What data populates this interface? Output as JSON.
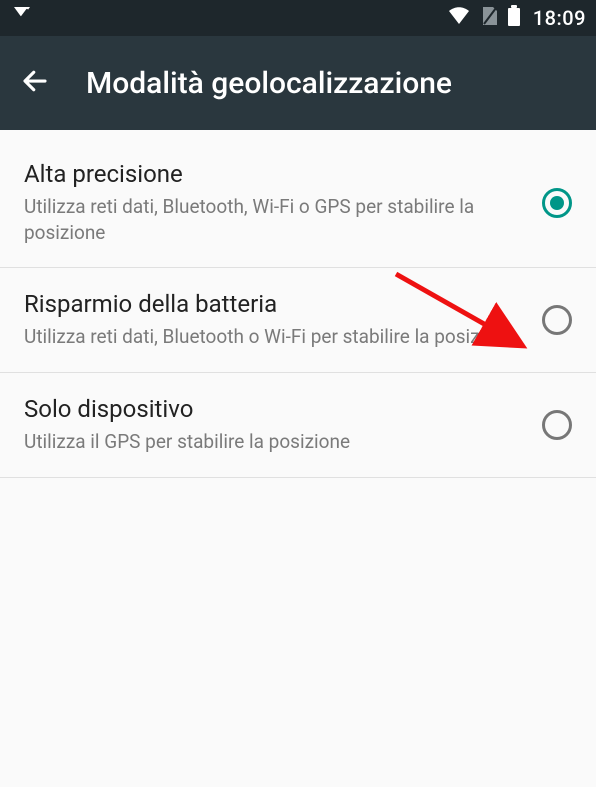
{
  "status_bar": {
    "time": "18:09"
  },
  "app_bar": {
    "title": "Modalità geolocalizzazione"
  },
  "options": [
    {
      "title": "Alta precisione",
      "description": "Utilizza reti dati, Bluetooth, Wi-Fi o GPS per stabilire la posizione",
      "selected": true
    },
    {
      "title": "Risparmio della batteria",
      "description": "Utilizza reti dati, Bluetooth o Wi-Fi per stabilire la posizione",
      "selected": false
    },
    {
      "title": "Solo dispositivo",
      "description": "Utilizza il GPS per stabilire la posizione",
      "selected": false
    }
  ]
}
